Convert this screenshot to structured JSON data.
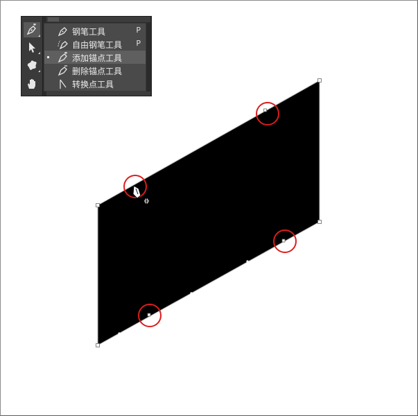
{
  "toolbar": {
    "tools": [
      {
        "name": "pen-tool",
        "icon": "pen-icon",
        "active": true
      },
      {
        "name": "path-selection-tool",
        "icon": "arrow-icon",
        "active": false
      },
      {
        "name": "custom-shape-tool",
        "icon": "blob-shape-icon",
        "active": false
      },
      {
        "name": "hand-tool",
        "icon": "hand-icon",
        "active": false
      }
    ]
  },
  "flyout": {
    "items": [
      {
        "label": "钢笔工具",
        "shortcut": "P",
        "icon": "pen-icon"
      },
      {
        "label": "自由钢笔工具",
        "shortcut": "P",
        "icon": "freeform-pen-icon"
      },
      {
        "label": "添加锚点工具",
        "shortcut": "",
        "icon": "add-anchor-icon",
        "selected": true
      },
      {
        "label": "删除锚点工具",
        "shortcut": "",
        "icon": "delete-anchor-icon"
      },
      {
        "label": "转换点工具",
        "shortcut": "",
        "icon": "convert-point-icon"
      }
    ]
  },
  "canvas": {
    "shape_color": "#000000",
    "highlight_color": "#dd1c1c",
    "background": "#ffffff"
  }
}
